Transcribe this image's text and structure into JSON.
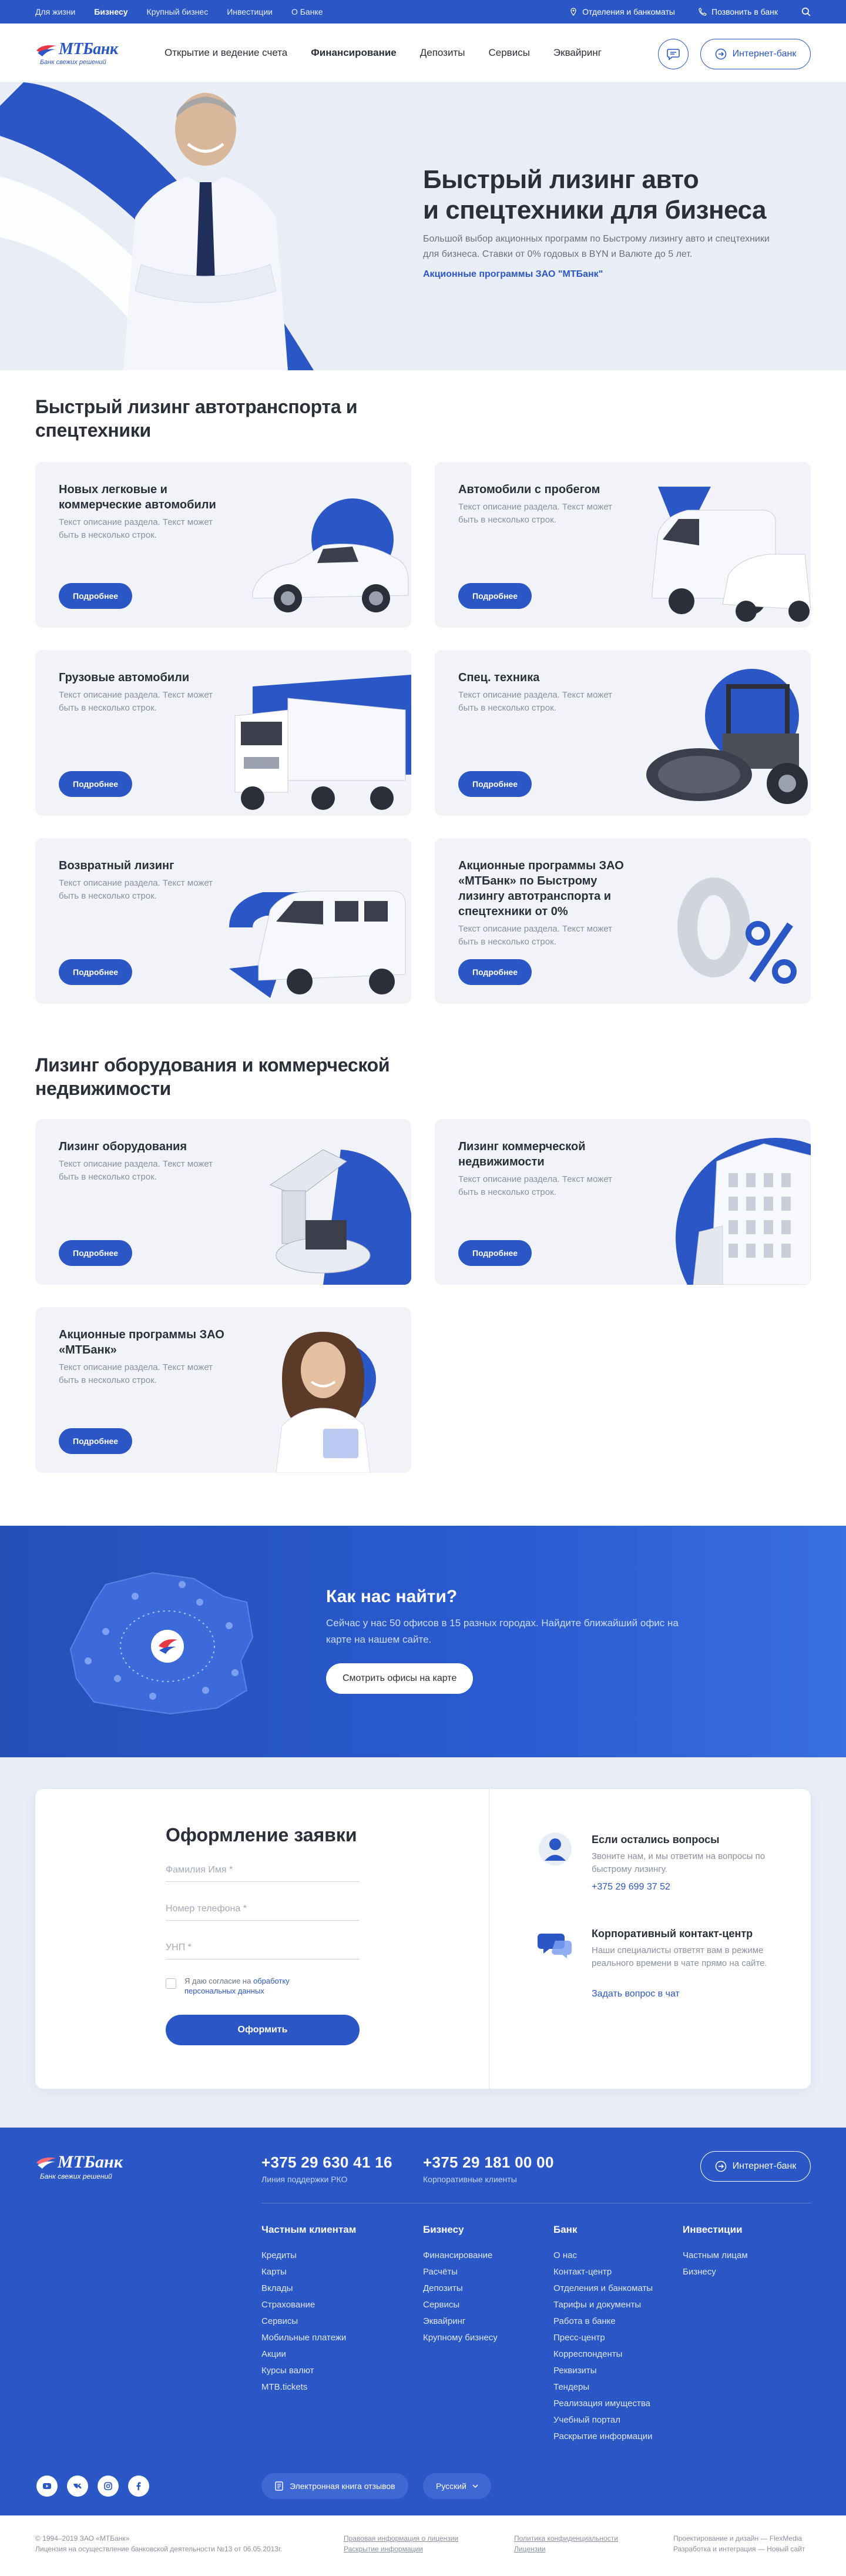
{
  "topbar": {
    "segments": [
      "Для жизни",
      "Бизнесу",
      "Крупный бизнес",
      "Инвестиции",
      "О Банке"
    ],
    "branches": "Отделения и банкоматы",
    "call": "Позвонить в банк"
  },
  "header": {
    "logo_brand": "МТБанк",
    "logo_tag": "Банк свежих решений",
    "nav": [
      "Открытие и ведение счета",
      "Финансирование",
      "Депозиты",
      "Сервисы",
      "Эквайринг"
    ],
    "internet_bank": "Интернет-банк"
  },
  "hero": {
    "title_line1": "Быстрый лизинг авто",
    "title_line2": "и спецтехники для бизнеса",
    "desc": "Большой выбор акционных программ по Быстрому лизингу авто и спецтехники для бизнеса. Ставки от 0% годовых в BYN и Валюте до 5 лет.",
    "link": "Акционные программы ЗАО \"МТБанк\""
  },
  "section1": {
    "title": "Быстрый лизинг автотранспорта и спецтехники",
    "cards": [
      {
        "title": "Новых легковые и коммерческие автомобили",
        "desc": "Текст описание раздела. Текст может быть в несколько строк.",
        "button": "Подробнее"
      },
      {
        "title": "Автомобили с пробегом",
        "desc": "Текст описание раздела. Текст может быть в несколько строк.",
        "button": "Подробнее"
      },
      {
        "title": "Грузовые автомобили",
        "desc": "Текст описание раздела. Текст может быть в несколько строк.",
        "button": "Подробнее"
      },
      {
        "title": "Спец. техника",
        "desc": "Текст описание раздела. Текст может быть в несколько строк.",
        "button": "Подробнее"
      },
      {
        "title": "Возвратный лизинг",
        "desc": "Текст описание раздела. Текст может быть в несколько строк.",
        "button": "Подробнее"
      },
      {
        "title": "Акционные программы ЗАО «МТБанк» по Быстрому лизингу автотранспорта и спецтехники от 0%",
        "desc": "Текст описание раздела. Текст может быть в несколько строк.",
        "button": "Подробнее"
      }
    ]
  },
  "section2": {
    "title": "Лизинг оборудования и коммерческой недвижимости",
    "cards": [
      {
        "title": "Лизинг оборудования",
        "desc": "Текст описание раздела. Текст может быть в несколько строк.",
        "button": "Подробнее"
      },
      {
        "title": "Лизинг коммерческой недвижимости",
        "desc": "Текст описание раздела. Текст может быть в несколько строк.",
        "button": "Подробнее"
      },
      {
        "title": "Акционные программы ЗАО «МТБанк»",
        "desc": "Текст описание раздела. Текст может быть в несколько строк.",
        "button": "Подробнее"
      }
    ]
  },
  "map": {
    "title": "Как нас найти?",
    "desc": "Сейчас у нас 50 офисов в 15 разных городах. Найдите ближайший офис на карте на нашем сайте.",
    "button": "Смотрить офисы на карте"
  },
  "form": {
    "title": "Оформление заявки",
    "name_placeholder": "Фамилия Имя *",
    "phone_placeholder": "Номер телефона *",
    "unp_placeholder": "УНП *",
    "consent_text": "Я даю согласие на",
    "consent_link": "обработку персональных данных",
    "submit": "Оформить"
  },
  "questions": {
    "title": "Если остались вопросы",
    "desc": "Звоните нам, и мы ответим на вопросы по быстрому лизингу.",
    "phone": "+375 29 699 37 52",
    "cc_title": "Корпоративный контакт-центр",
    "cc_desc": "Наши специалисты ответят вам в режиме реального времени в чате прямо на сайте.",
    "cc_link": "Задать вопрос в чат"
  },
  "footer": {
    "logo_brand": "МТБанк",
    "logo_tag": "Банк свежих решений",
    "phone1": "+375 29 630 41 16",
    "phone1_sub": "Линия поддержки РКО",
    "phone2": "+375 29 181 00 00",
    "phone2_sub": "Корпоративные клиенты",
    "internet_bank": "Интернет-банк",
    "columns": [
      {
        "title": "Частным клиентам",
        "items": [
          "Кредиты",
          "Карты",
          "Вклады",
          "Страхование",
          "Сервисы",
          "Мобильные платежи",
          "Акции",
          "Курсы валют",
          "MTB.tickets"
        ]
      },
      {
        "title": "Бизнесу",
        "items": [
          "Финансирование",
          "Расчёты",
          "Депозиты",
          "Сервисы",
          "Эквайринг",
          "Крупному бизнесу"
        ]
      },
      {
        "title": "Банк",
        "items": [
          "О нас",
          "Контакт-центр",
          "Отделения и банкоматы",
          "Тарифы и документы",
          "Работа в банке",
          "Пресс-центр",
          "Корреспонденты",
          "Реквизиты",
          "Тендеры",
          "Реализация имущества",
          "Учебный портал",
          "Раскрытие информации"
        ]
      },
      {
        "title": "Инвестиции",
        "items": [
          "Частным лицам",
          "Бизнесу"
        ]
      }
    ],
    "social": [
      "yt",
      "vk",
      "ig",
      "f"
    ],
    "book": "Электронная книга отзывов",
    "lang": "Русский"
  },
  "legal": {
    "copy1": "© 1994–2019 ЗАО «МТБанк»",
    "copy2": "Лицензия на осуществление банковской деятельности №13 от 06.05.2013г.",
    "l1": "Правовая информация о лицензии",
    "l2": "Раскрытие информации",
    "l3": "Политика конфиденциальности",
    "l4": "Лицензии",
    "d1": "Проектирование и дизайн — FlexMedia",
    "d2": "Разработка и интеграция — Новый сайт"
  },
  "colors": {
    "brand": "#2a56c6",
    "bg_light": "#f1f3f8",
    "hero_bg": "#e8edf6"
  }
}
